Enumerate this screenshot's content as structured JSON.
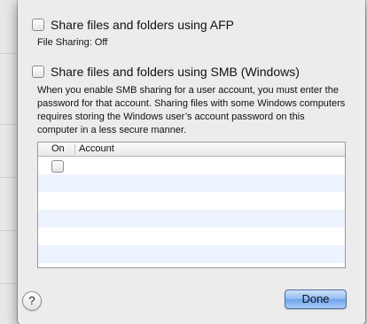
{
  "afp": {
    "label": "Share files and folders using AFP",
    "checked": false,
    "status": "File Sharing: Off"
  },
  "smb": {
    "label": "Share files and folders using SMB (Windows)",
    "checked": false,
    "description": "When you enable SMB sharing for a user account, you must enter the password for that account. Sharing files with some Windows computers requires storing the Windows user’s account password on this computer in a less secure manner."
  },
  "accounts_table": {
    "columns": [
      "On",
      "Account"
    ],
    "rows": [
      {
        "on": false,
        "account": ""
      }
    ]
  },
  "buttons": {
    "help_label": "?",
    "done_label": "Done"
  },
  "colors": {
    "done_button": "#8fbaf0",
    "table_alt_row": "#edf3fe"
  },
  "icons": {
    "help": "question-mark-icon"
  }
}
